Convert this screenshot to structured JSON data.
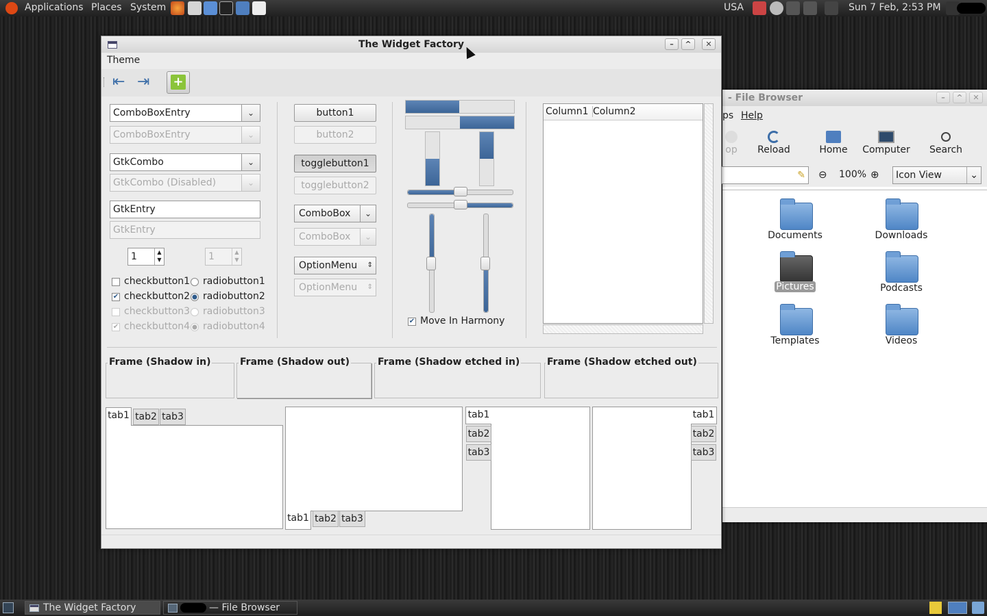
{
  "top_panel": {
    "menus": [
      "Applications",
      "Places",
      "System"
    ],
    "keyboard": "USA",
    "clock": "Sun  7 Feb,  2:53 PM"
  },
  "bottom_panel": {
    "tasks": [
      "The Widget Factory",
      "— File Browser"
    ]
  },
  "file_browser": {
    "title": "- File Browser",
    "menu": [
      "ps",
      "Help"
    ],
    "toolbar": [
      "op",
      "Reload",
      "Home",
      "Computer",
      "Search"
    ],
    "zoom": "100%",
    "view_mode": "Icon View",
    "items": [
      "Documents",
      "Downloads",
      "Pictures",
      "Podcasts",
      "Templates",
      "Videos"
    ],
    "selected": "Pictures"
  },
  "widget_factory": {
    "title": "The Widget Factory",
    "menu": "Theme",
    "combo_entry": "ComboBoxEntry",
    "combo_entry_disabled": "ComboBoxEntry",
    "gtk_combo": "GtkCombo",
    "gtk_combo_disabled": "GtkCombo (Disabled)",
    "entry": "GtkEntry",
    "entry_disabled": "GtkEntry",
    "spin1": "1",
    "spin2": "1",
    "checks": [
      "checkbutton1",
      "checkbutton2",
      "checkbutton3",
      "checkbutton4"
    ],
    "radios": [
      "radiobutton1",
      "radiobutton2",
      "radiobutton3",
      "radiobutton4"
    ],
    "buttons": [
      "button1",
      "button2",
      "togglebutton1",
      "togglebutton2"
    ],
    "combobox": "ComboBox",
    "combobox_disabled": "ComboBox",
    "optionmenu": "OptionMenu",
    "optionmenu_disabled": "OptionMenu",
    "move_harmony": "Move In Harmony",
    "progress": {
      "h1": 0.5,
      "h2": 0.5,
      "v1": 0.5,
      "v2": 0.5
    },
    "scales": {
      "h1": 0.5,
      "h2": 0.5,
      "v1": 0.5,
      "v2": 0.5
    },
    "tree_columns": [
      "Column1",
      "Column2"
    ],
    "frames": [
      "Frame (Shadow in)",
      "Frame (Shadow out)",
      "Frame (Shadow etched in)",
      "Frame (Shadow etched out)"
    ],
    "tabs": [
      "tab1",
      "tab2",
      "tab3"
    ]
  }
}
